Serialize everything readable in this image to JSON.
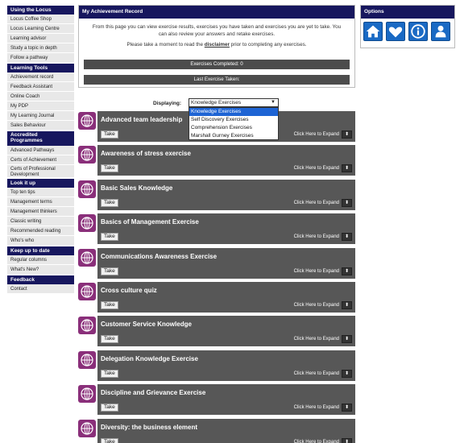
{
  "sidebar": {
    "sections": [
      {
        "title": "Using the Locus",
        "items": [
          "Locus Coffee Shop",
          "Locus Learning Centre",
          "Learning advisor",
          "Study a topic in depth",
          "Follow a pathway"
        ]
      },
      {
        "title": "Learning Tools",
        "items": [
          "Achievement record",
          "Feedback Assistant",
          "Online Coach",
          "My PDP",
          "My Learning Journal",
          "Sales Behaviour"
        ]
      },
      {
        "title": "Accredited Programmes",
        "items": [
          "Advanced Pathways",
          "Certs of Achievement",
          "Certs of Professional Development"
        ]
      },
      {
        "title": "Look it up",
        "items": [
          "Top ten tips",
          "Management terms",
          "Management thinkers",
          "Classic writing",
          "Recommended reading",
          "Who's who"
        ]
      },
      {
        "title": "Keep up to date",
        "items": [
          "Regular columns",
          "What's New?"
        ]
      },
      {
        "title": "Feedback",
        "items": [
          "Contact"
        ]
      }
    ]
  },
  "achievement": {
    "title": "My Achievement Record",
    "intro": "From this page you can view exercise results, exercises you have taken and exercises you are yet to take. You can also review your answers and retake exercises.",
    "note_before": "Please take a moment to read the ",
    "note_link": "disclaimer",
    "note_after": " prior to completing any exercises.",
    "completed_label": "Exercises Completed: 0",
    "last_label": "Last Exercise Taken:"
  },
  "options": {
    "title": "Options",
    "icons": [
      "home-icon",
      "heart-icon",
      "info-icon",
      "user-icon"
    ],
    "color": "#1a6ac4"
  },
  "displaying": {
    "label": "Displaying:",
    "selected": "Knowledge Exercises",
    "options": [
      "Knowledge Exercises",
      "Self Discovery Exercises",
      "Comprehension Exercises",
      "Marshall Gurney Exercises"
    ]
  },
  "exercises": {
    "take_label": "Take",
    "expand_label": "Click Here to Expand",
    "items": [
      "Advanced team leadership",
      "Awareness of stress exercise",
      "Basic Sales Knowledge",
      "Basics of Management Exercise",
      "Communications Awareness Exercise",
      "Cross culture quiz",
      "Customer Service Knowledge",
      "Delegation Knowledge Exercise",
      "Discipline and Grievance Exercise",
      "Diversity: the business element"
    ]
  }
}
